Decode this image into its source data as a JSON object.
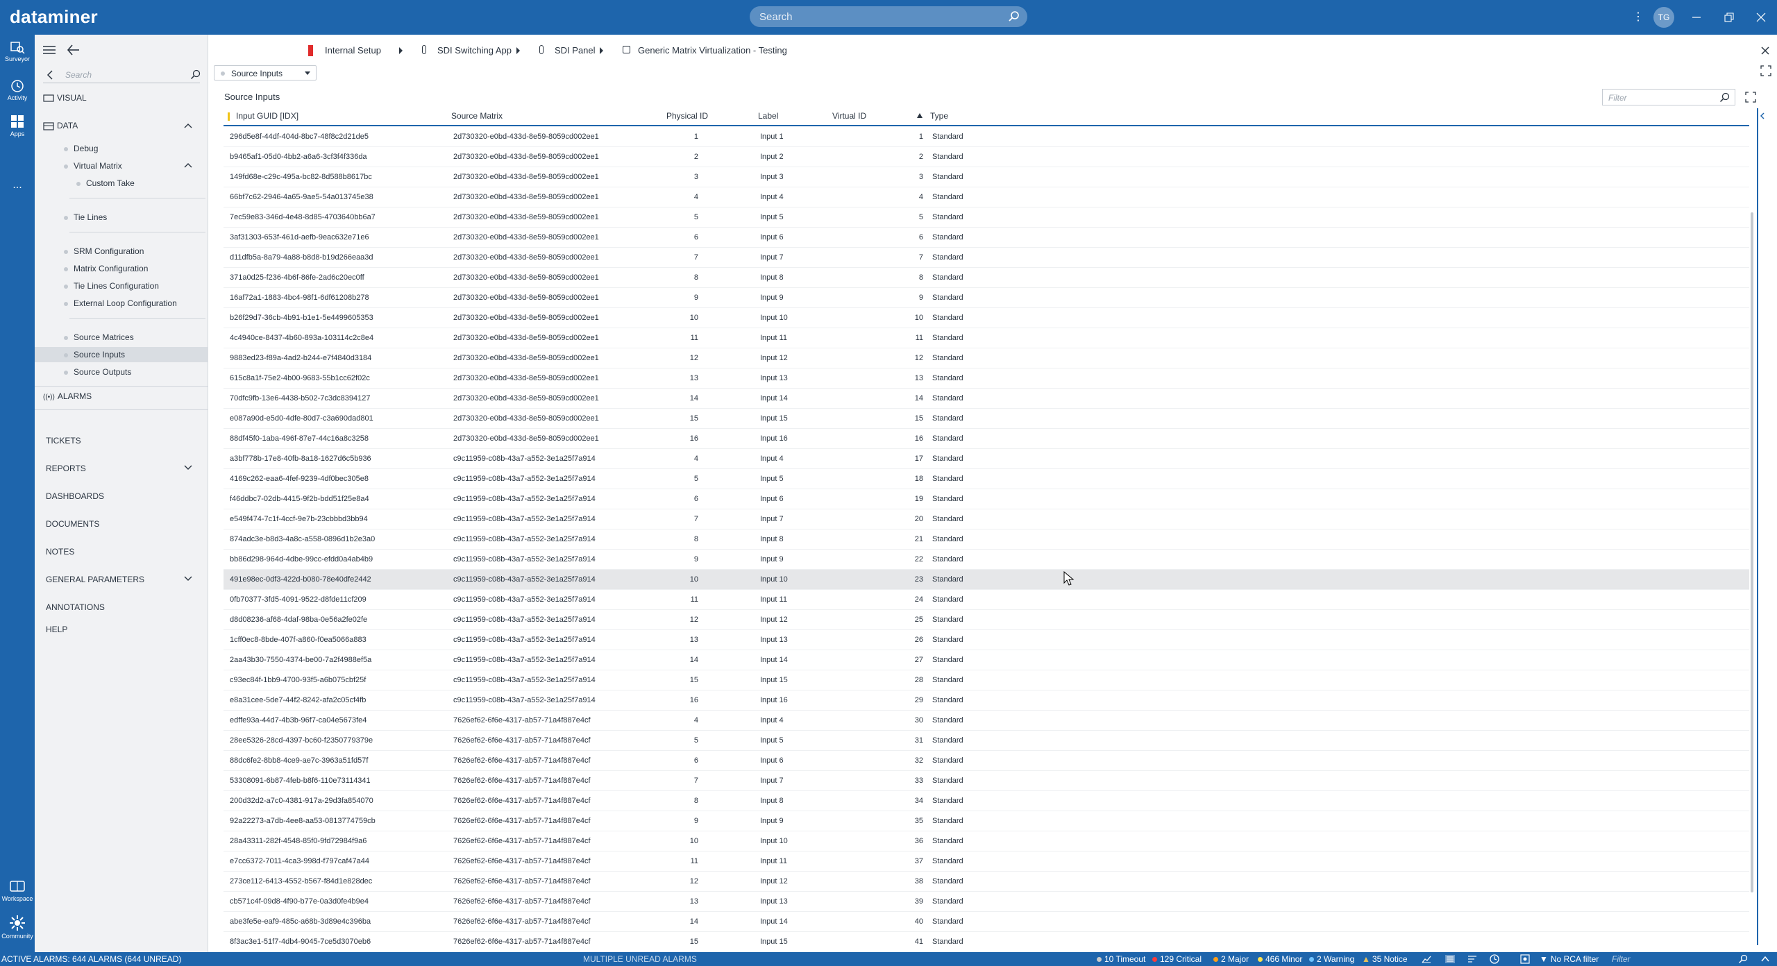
{
  "app": {
    "logo": "dataminer"
  },
  "search": {
    "placeholder": "Search"
  },
  "user": {
    "initials": "TG"
  },
  "rail": {
    "surveyor": "Surveyor",
    "activity": "Activity",
    "apps": "Apps",
    "more": "...",
    "workspace": "Workspace",
    "community": "Community"
  },
  "nav": {
    "search_placeholder": "Search",
    "visual": "VISUAL",
    "data": "DATA",
    "debug": "Debug",
    "virtual_matrix": "Virtual Matrix",
    "custom_take": "Custom Take",
    "tie_lines": "Tie Lines",
    "srm_configuration": "SRM Configuration",
    "matrix_configuration": "Matrix Configuration",
    "tie_lines_configuration": "Tie Lines Configuration",
    "external_loop_configuration": "External Loop Configuration",
    "source_matrices": "Source Matrices",
    "source_inputs": "Source Inputs",
    "source_outputs": "Source Outputs",
    "alarms": "ALARMS",
    "tickets": "TICKETS",
    "reports": "REPORTS",
    "dashboards": "DASHBOARDS",
    "documents": "DOCUMENTS",
    "notes": "NOTES",
    "general_parameters": "GENERAL PARAMETERS",
    "annotations": "ANNOTATIONS",
    "help": "HELP"
  },
  "breadcrumb": {
    "internal_setup": "Internal Setup",
    "sdi_switching_app": "SDI Switching App",
    "sdi_panel": "SDI Panel",
    "generic_matrix": "Generic Matrix Virtualization - Testing"
  },
  "page_selector": {
    "value": "Source Inputs"
  },
  "table": {
    "title": "Source Inputs",
    "filter_placeholder": "Filter",
    "columns": [
      "Input GUID [IDX]",
      "Source Matrix",
      "Physical ID",
      "Label",
      "Virtual ID",
      "Type"
    ],
    "rows": [
      [
        "296d5e8f-44df-404d-8bc7-48f8c2d21de5",
        "2d730320-e0bd-433d-8e59-8059cd002ee1",
        "1",
        "Input 1",
        "1",
        "Standard"
      ],
      [
        "b9465af1-05d0-4bb2-a6a6-3cf3f4f336da",
        "2d730320-e0bd-433d-8e59-8059cd002ee1",
        "2",
        "Input 2",
        "2",
        "Standard"
      ],
      [
        "149fd68e-c29c-495a-bc82-8d588b8617bc",
        "2d730320-e0bd-433d-8e59-8059cd002ee1",
        "3",
        "Input 3",
        "3",
        "Standard"
      ],
      [
        "66bf7c62-2946-4a65-9ae5-54a013745e38",
        "2d730320-e0bd-433d-8e59-8059cd002ee1",
        "4",
        "Input 4",
        "4",
        "Standard"
      ],
      [
        "7ec59e83-346d-4e48-8d85-4703640bb6a7",
        "2d730320-e0bd-433d-8e59-8059cd002ee1",
        "5",
        "Input 5",
        "5",
        "Standard"
      ],
      [
        "3af31303-653f-461d-aefb-9eac632e71e6",
        "2d730320-e0bd-433d-8e59-8059cd002ee1",
        "6",
        "Input 6",
        "6",
        "Standard"
      ],
      [
        "d11dfb5a-8a79-4a88-b8d8-b19d266eaa3d",
        "2d730320-e0bd-433d-8e59-8059cd002ee1",
        "7",
        "Input 7",
        "7",
        "Standard"
      ],
      [
        "371a0d25-f236-4b6f-86fe-2ad6c20ec0ff",
        "2d730320-e0bd-433d-8e59-8059cd002ee1",
        "8",
        "Input 8",
        "8",
        "Standard"
      ],
      [
        "16af72a1-1883-4bc4-98f1-6df61208b278",
        "2d730320-e0bd-433d-8e59-8059cd002ee1",
        "9",
        "Input 9",
        "9",
        "Standard"
      ],
      [
        "b26f29d7-36cb-4b91-b1e1-5e4499605353",
        "2d730320-e0bd-433d-8e59-8059cd002ee1",
        "10",
        "Input 10",
        "10",
        "Standard"
      ],
      [
        "4c4940ce-8437-4b60-893a-103114c2c8e4",
        "2d730320-e0bd-433d-8e59-8059cd002ee1",
        "11",
        "Input 11",
        "11",
        "Standard"
      ],
      [
        "9883ed23-f89a-4ad2-b244-e7f4840d3184",
        "2d730320-e0bd-433d-8e59-8059cd002ee1",
        "12",
        "Input 12",
        "12",
        "Standard"
      ],
      [
        "615c8a1f-75e2-4b00-9683-55b1cc62f02c",
        "2d730320-e0bd-433d-8e59-8059cd002ee1",
        "13",
        "Input 13",
        "13",
        "Standard"
      ],
      [
        "70dfc9fb-13e6-4438-b502-7c3dc8394127",
        "2d730320-e0bd-433d-8e59-8059cd002ee1",
        "14",
        "Input 14",
        "14",
        "Standard"
      ],
      [
        "e087a90d-e5d0-4dfe-80d7-c3a690dad801",
        "2d730320-e0bd-433d-8e59-8059cd002ee1",
        "15",
        "Input 15",
        "15",
        "Standard"
      ],
      [
        "88df45f0-1aba-496f-87e7-44c16a8c3258",
        "2d730320-e0bd-433d-8e59-8059cd002ee1",
        "16",
        "Input 16",
        "16",
        "Standard"
      ],
      [
        "a3bf778b-17e8-40fb-8a18-1627d6c5b936",
        "c9c11959-c08b-43a7-a552-3e1a25f7a914",
        "4",
        "Input 4",
        "17",
        "Standard"
      ],
      [
        "4169c262-eaa6-4fef-9239-4df0bec305e8",
        "c9c11959-c08b-43a7-a552-3e1a25f7a914",
        "5",
        "Input 5",
        "18",
        "Standard"
      ],
      [
        "f46ddbc7-02db-4415-9f2b-bdd51f25e8a4",
        "c9c11959-c08b-43a7-a552-3e1a25f7a914",
        "6",
        "Input 6",
        "19",
        "Standard"
      ],
      [
        "e549f474-7c1f-4ccf-9e7b-23cbbbd3bb94",
        "c9c11959-c08b-43a7-a552-3e1a25f7a914",
        "7",
        "Input 7",
        "20",
        "Standard"
      ],
      [
        "874adc3e-b8d3-4a8c-a558-0896d1b2e3a0",
        "c9c11959-c08b-43a7-a552-3e1a25f7a914",
        "8",
        "Input 8",
        "21",
        "Standard"
      ],
      [
        "bb86d298-964d-4dbe-99cc-efdd0a4ab4b9",
        "c9c11959-c08b-43a7-a552-3e1a25f7a914",
        "9",
        "Input 9",
        "22",
        "Standard"
      ],
      [
        "491e98ec-0df3-422d-b080-78e40dfe2442",
        "c9c11959-c08b-43a7-a552-3e1a25f7a914",
        "10",
        "Input 10",
        "23",
        "Standard"
      ],
      [
        "0fb70377-3fd5-4091-9522-d8fde11cf209",
        "c9c11959-c08b-43a7-a552-3e1a25f7a914",
        "11",
        "Input 11",
        "24",
        "Standard"
      ],
      [
        "d8d08236-af68-4daf-98ba-0e56a2fe02fe",
        "c9c11959-c08b-43a7-a552-3e1a25f7a914",
        "12",
        "Input 12",
        "25",
        "Standard"
      ],
      [
        "1cff0ec8-8bde-407f-a860-f0ea5066a883",
        "c9c11959-c08b-43a7-a552-3e1a25f7a914",
        "13",
        "Input 13",
        "26",
        "Standard"
      ],
      [
        "2aa43b30-7550-4374-be00-7a2f4988ef5a",
        "c9c11959-c08b-43a7-a552-3e1a25f7a914",
        "14",
        "Input 14",
        "27",
        "Standard"
      ],
      [
        "c93ec84f-1bb9-4700-93f5-a6b075cbf25f",
        "c9c11959-c08b-43a7-a552-3e1a25f7a914",
        "15",
        "Input 15",
        "28",
        "Standard"
      ],
      [
        "e8a31cee-5de7-44f2-8242-afa2c05cf4fb",
        "c9c11959-c08b-43a7-a552-3e1a25f7a914",
        "16",
        "Input 16",
        "29",
        "Standard"
      ],
      [
        "edffe93a-44d7-4b3b-96f7-ca04e5673fe4",
        "7626ef62-6f6e-4317-ab57-71a4f887e4cf",
        "4",
        "Input 4",
        "30",
        "Standard"
      ],
      [
        "28ee5326-28cd-4397-bc60-f2350779379e",
        "7626ef62-6f6e-4317-ab57-71a4f887e4cf",
        "5",
        "Input 5",
        "31",
        "Standard"
      ],
      [
        "88dc6fe2-8bb8-4ce9-ae7c-3963a51fd57f",
        "7626ef62-6f6e-4317-ab57-71a4f887e4cf",
        "6",
        "Input 6",
        "32",
        "Standard"
      ],
      [
        "53308091-6b87-4feb-b8f6-110e73114341",
        "7626ef62-6f6e-4317-ab57-71a4f887e4cf",
        "7",
        "Input 7",
        "33",
        "Standard"
      ],
      [
        "200d32d2-a7c0-4381-917a-29d3fa854070",
        "7626ef62-6f6e-4317-ab57-71a4f887e4cf",
        "8",
        "Input 8",
        "34",
        "Standard"
      ],
      [
        "92a22273-a7db-4ee8-aa53-0813774759cb",
        "7626ef62-6f6e-4317-ab57-71a4f887e4cf",
        "9",
        "Input 9",
        "35",
        "Standard"
      ],
      [
        "28a43311-282f-4548-85f0-9fd72984f9a6",
        "7626ef62-6f6e-4317-ab57-71a4f887e4cf",
        "10",
        "Input 10",
        "36",
        "Standard"
      ],
      [
        "e7cc6372-7011-4ca3-998d-f797caf47a44",
        "7626ef62-6f6e-4317-ab57-71a4f887e4cf",
        "11",
        "Input 11",
        "37",
        "Standard"
      ],
      [
        "273ce112-6413-4552-b567-f84d1e828dec",
        "7626ef62-6f6e-4317-ab57-71a4f887e4cf",
        "12",
        "Input 12",
        "38",
        "Standard"
      ],
      [
        "cb571c4f-09d8-4f90-b77e-0a3d0fe4b9e4",
        "7626ef62-6f6e-4317-ab57-71a4f887e4cf",
        "13",
        "Input 13",
        "39",
        "Standard"
      ],
      [
        "abe3fe5e-eaf9-485c-a68b-3d89e4c396ba",
        "7626ef62-6f6e-4317-ab57-71a4f887e4cf",
        "14",
        "Input 14",
        "40",
        "Standard"
      ],
      [
        "8f3ac3e1-51f7-4db4-9045-7ce5d3070eb6",
        "7626ef62-6f6e-4317-ab57-71a4f887e4cf",
        "15",
        "Input 15",
        "41",
        "Standard"
      ]
    ],
    "highlighted_row": 22
  },
  "statusbar": {
    "active_alarms": "ACTIVE ALARMS: 644 ALARMS (644 UNREAD)",
    "multiple_unread": "MULTIPLE UNREAD ALARMS",
    "timeout": "10 Timeout",
    "critical": "129 Critical",
    "major": "2 Major",
    "minor": "466 Minor",
    "warning": "2 Warning",
    "notice": "35 Notice",
    "no_rca": "No RCA filter",
    "filter_placeholder": "Filter"
  },
  "colors": {
    "brand": "#1e65ac",
    "timeout": "#c9c9c9",
    "critical": "#ff3b3b",
    "major": "#ff9f1a",
    "minor": "#ffe14d",
    "warning": "#6fc3ff",
    "notice": "#e8c15a"
  }
}
